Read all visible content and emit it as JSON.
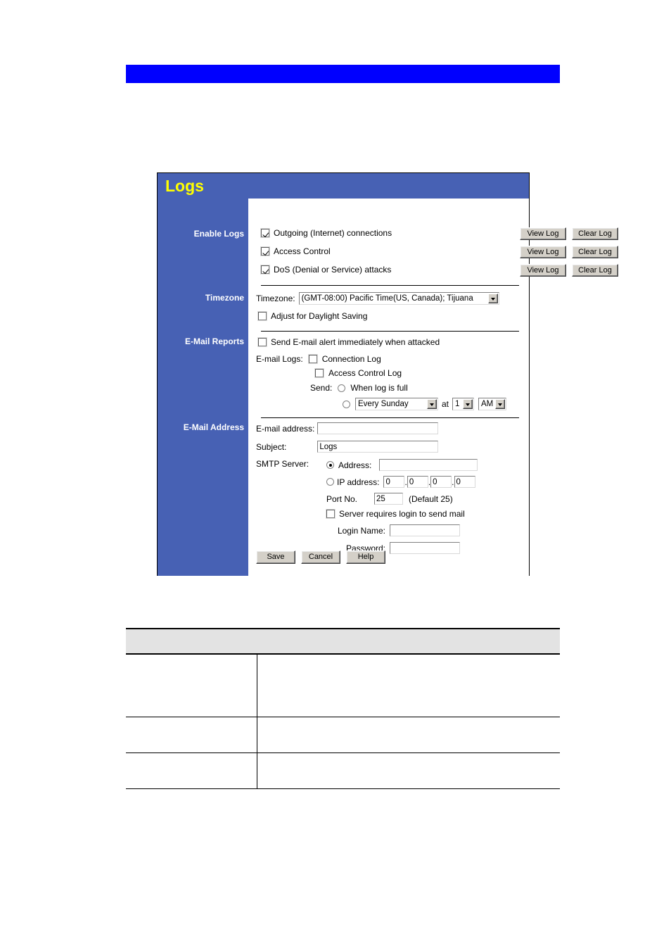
{
  "banner": {
    "text": ""
  },
  "panel": {
    "title": "Logs",
    "sections": {
      "enable_logs_label": "Enable Logs",
      "timezone_label": "Timezone",
      "email_reports_label": "E-Mail Reports",
      "email_address_label": "E-Mail Address"
    },
    "enable_logs": {
      "items": [
        {
          "label": "Outgoing (Internet) connections",
          "checked": true,
          "view_label": "View Log",
          "clear_label": "Clear Log"
        },
        {
          "label": "Access Control",
          "checked": true,
          "view_label": "View Log",
          "clear_label": "Clear Log"
        },
        {
          "label": "DoS (Denial or Service) attacks",
          "checked": true,
          "view_label": "View Log",
          "clear_label": "Clear Log"
        }
      ]
    },
    "timezone": {
      "field_label": "Timezone:",
      "selected": "(GMT-08:00) Pacific Time(US, Canada); Tijuana",
      "daylight_label": "Adjust for Daylight Saving",
      "daylight_checked": false
    },
    "email_reports": {
      "alert_label": "Send E-mail alert immediately when attacked",
      "alert_checked": false,
      "logs_label": "E-mail Logs:",
      "connection_log_label": "Connection Log",
      "connection_log_checked": false,
      "access_control_log_label": "Access Control Log",
      "access_control_log_checked": false,
      "send_label": "Send:",
      "when_full_label": "When log is full",
      "when_full_selected": false,
      "schedule_selected": false,
      "schedule_day": "Every Sunday",
      "at_label": "at",
      "schedule_hour": "1",
      "schedule_meridiem": "AM"
    },
    "email_address": {
      "email_label": "E-mail address:",
      "email_value": "",
      "subject_label": "Subject:",
      "subject_value": "Logs",
      "smtp_label": "SMTP Server:",
      "address_radio_label": "Address:",
      "address_radio_selected": true,
      "address_value": "",
      "ip_radio_label": "IP address:",
      "ip_radio_selected": false,
      "ip_octets": [
        "0",
        "0",
        "0",
        "0"
      ],
      "port_label": "Port No.",
      "port_value": "25",
      "port_default_note": "(Default  25)",
      "requires_login_label": "Server requires login to send mail",
      "requires_login_checked": false,
      "login_name_label": "Login Name:",
      "login_name_value": "",
      "password_label": "Password:",
      "password_value": ""
    },
    "buttons": {
      "save": "Save",
      "cancel": "Cancel",
      "help": "Help"
    }
  },
  "desc_table": {
    "header": [
      ""
    ],
    "rows": [
      {
        "name": "",
        "description": ""
      },
      {
        "name": "",
        "description": ""
      },
      {
        "name": "",
        "description": ""
      }
    ]
  },
  "colors": {
    "banner_blue": "#0000ff",
    "panel_blue": "#4761b4",
    "title_yellow": "#ffff00",
    "table_header_gray": "#e3e3e3"
  }
}
